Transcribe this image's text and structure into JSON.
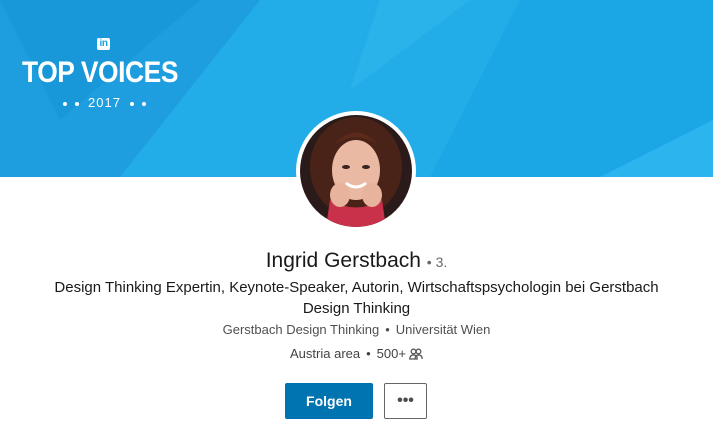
{
  "banner": {
    "logo_text": "in",
    "title": "TOP VOICES",
    "year": "2017",
    "color": "#1aa3e6"
  },
  "profile": {
    "name": "Ingrid Gerstbach",
    "degree": "3.",
    "headline": "Design Thinking Expertin, Keynote-Speaker, Autorin, Wirtschaftspsychologin bei Gerstbach Design Thinking",
    "company": "Gerstbach Design Thinking",
    "school": "Universität Wien",
    "location": "Austria area",
    "connections": "500+"
  },
  "actions": {
    "follow_label": "Folgen",
    "more_label": "•••"
  },
  "icons": {
    "linkedin": "linkedin-logo-icon",
    "connections": "people-icon",
    "more": "ellipsis-icon"
  },
  "colors": {
    "primary": "#0073b1"
  }
}
